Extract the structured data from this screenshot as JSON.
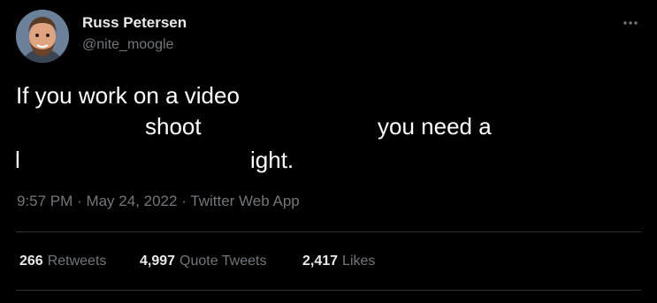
{
  "author": {
    "display_name": "Russ Petersen",
    "handle": "@nite_moogle"
  },
  "tweet": {
    "text_fragments": [
      "If you work on a video",
      "shoot",
      "you need a",
      "l",
      "ight."
    ],
    "timestamp": "9:57 PM",
    "separator": "·",
    "date": "May 24, 2022",
    "client": "Twitter Web App"
  },
  "stats": {
    "retweets": {
      "count": "266",
      "label": "Retweets"
    },
    "quote_tweets": {
      "count": "4,997",
      "label": "Quote Tweets"
    },
    "likes": {
      "count": "2,417",
      "label": "Likes"
    }
  },
  "icons": {
    "more": "more-horizontal-icon",
    "avatar": "avatar-illustration"
  },
  "colors": {
    "background": "#000000",
    "primary_text": "#e7e9ea",
    "secondary_text": "#71767b",
    "divider": "#2f3336"
  }
}
